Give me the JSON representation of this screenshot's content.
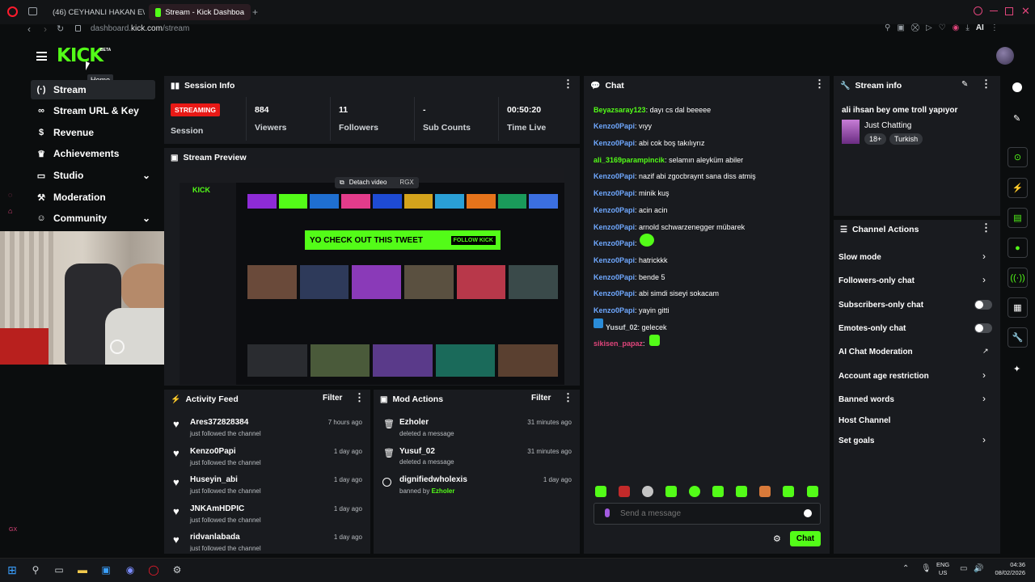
{
  "browser": {
    "tabs": [
      {
        "label": "(46) CEYHANLI HAKAN E\\"
      },
      {
        "label": "Stream - Kick Dashboa"
      }
    ],
    "url_host": "dashboard.",
    "url_domain": "kick.com",
    "url_path": "/stream"
  },
  "brand": {
    "logo": "KICK",
    "beta": "BETA",
    "tooltip": "Home"
  },
  "sidebar": {
    "items": [
      {
        "label": "Stream",
        "icon": "stream-icon"
      },
      {
        "label": "Stream URL & Key",
        "icon": "link-icon"
      },
      {
        "label": "Revenue",
        "icon": "dollar-icon"
      },
      {
        "label": "Achievements",
        "icon": "trophy-icon"
      },
      {
        "label": "Studio",
        "icon": "studio-icon"
      },
      {
        "label": "Moderation",
        "icon": "hammer-icon"
      },
      {
        "label": "Community",
        "icon": "community-icon"
      }
    ]
  },
  "session": {
    "title": "Session Info",
    "badge": "STREAMING",
    "stats": [
      {
        "value": "884",
        "label": "Viewers"
      },
      {
        "value": "11",
        "label": "Followers"
      },
      {
        "value": "-",
        "label": "Sub Counts"
      },
      {
        "value": "00:50:20",
        "label": "Time Live"
      }
    ],
    "session_label": "Session"
  },
  "preview": {
    "title": "Stream Preview",
    "detach": "Detach video",
    "rgx": "RGX",
    "promo": "YO CHECK OUT THIS TWEET",
    "promo_btn": "FOLLOW KICK"
  },
  "activity": {
    "title": "Activity Feed",
    "filter": "Filter",
    "items": [
      {
        "name": "Ares372828384",
        "sub": "just followed the channel",
        "time": "7 hours ago"
      },
      {
        "name": "Kenzo0Papi",
        "sub": "just followed the channel",
        "time": "1 day ago"
      },
      {
        "name": "Huseyin_abi",
        "sub": "just followed the channel",
        "time": "1 day ago"
      },
      {
        "name": "JNKAmHDPIC",
        "sub": "just followed the channel",
        "time": "1 day ago"
      },
      {
        "name": "ridvanlabada",
        "sub": "just followed the channel",
        "time": "1 day ago"
      }
    ]
  },
  "mod_actions": {
    "title": "Mod Actions",
    "filter": "Filter",
    "items": [
      {
        "name": "Ezholer",
        "sub": "deleted a message",
        "time": "31 minutes ago"
      },
      {
        "name": "Yusuf_02",
        "sub": "deleted a message",
        "time": "31 minutes ago"
      },
      {
        "name": "dignifiedwholexis",
        "sub": "banned by ",
        "by": "Ezholer",
        "time": "1 day ago"
      }
    ]
  },
  "chat": {
    "title": "Chat",
    "messages": [
      {
        "user": "Beyazsaray123",
        "text": ": dayı cs dal beeeee",
        "color": "#53fc18"
      },
      {
        "user": "Kenzo0Papi",
        "text": ": vıyy",
        "color": "#6fa8ff"
      },
      {
        "user": "Kenzo0Papi",
        "text": ": abi cok boş takılıyrız",
        "color": "#6fa8ff"
      },
      {
        "user": "ali_3169parampincik",
        "text": ": selamın aleyküm abiler",
        "color": "#53fc18"
      },
      {
        "user": "Kenzo0Papi",
        "text": ": nazif abi zgocbraynt sana diss atmiş",
        "color": "#6fa8ff"
      },
      {
        "user": "Kenzo0Papi",
        "text": ": minik kuş",
        "color": "#6fa8ff"
      },
      {
        "user": "Kenzo0Papi",
        "text": ": acin acin",
        "color": "#6fa8ff"
      },
      {
        "user": "Kenzo0Papi",
        "text": ": arnold schwarzenegger mübarek",
        "color": "#6fa8ff"
      },
      {
        "user": "Kenzo0Papi",
        "text": ":",
        "color": "#6fa8ff"
      },
      {
        "user": "Kenzo0Papi",
        "text": ": hatrickkk",
        "color": "#6fa8ff"
      },
      {
        "user": "Kenzo0Papi",
        "text": ": bende 5",
        "color": "#6fa8ff"
      },
      {
        "user": "Kenzo0Papi",
        "text": ": abi simdi siseyi sokacam",
        "color": "#6fa8ff"
      },
      {
        "user": "Kenzo0Papi",
        "text": ": yayin gitti",
        "color": "#6fa8ff"
      },
      {
        "user": "Yusuf_02",
        "text": ": gelecek",
        "color": "#cfd3d6"
      },
      {
        "user": "sikisen_papaz",
        "text": ":",
        "color": "#e0457b"
      }
    ],
    "placeholder": "Send a message",
    "send": "Chat"
  },
  "stream_info": {
    "title": "Stream info",
    "stream_title": "ali ihsan bey ome troll yapıyor",
    "category": "Just Chatting",
    "tags": [
      "18+",
      "Turkish"
    ]
  },
  "channel_actions": {
    "title": "Channel Actions",
    "items": [
      {
        "label": "Slow mode",
        "control": "chevron"
      },
      {
        "label": "Followers-only chat",
        "control": "chevron"
      },
      {
        "label": "Subscribers-only chat",
        "control": "toggle"
      },
      {
        "label": "Emotes-only chat",
        "control": "toggle"
      },
      {
        "label": "AI Chat Moderation",
        "control": "external"
      },
      {
        "label": "Account age restriction",
        "control": "chevron"
      },
      {
        "label": "Banned words",
        "control": "chevron"
      },
      {
        "label": "Host Channel",
        "control": "none"
      },
      {
        "label": "Set goals",
        "control": "chevron"
      }
    ]
  },
  "taskbar": {
    "lang": "ENG",
    "region": "US",
    "time": "04:36",
    "date": "08/02/2026"
  },
  "colors": {
    "accent": "#53fc18",
    "live": "#e91916",
    "panel": "#191b1f"
  }
}
